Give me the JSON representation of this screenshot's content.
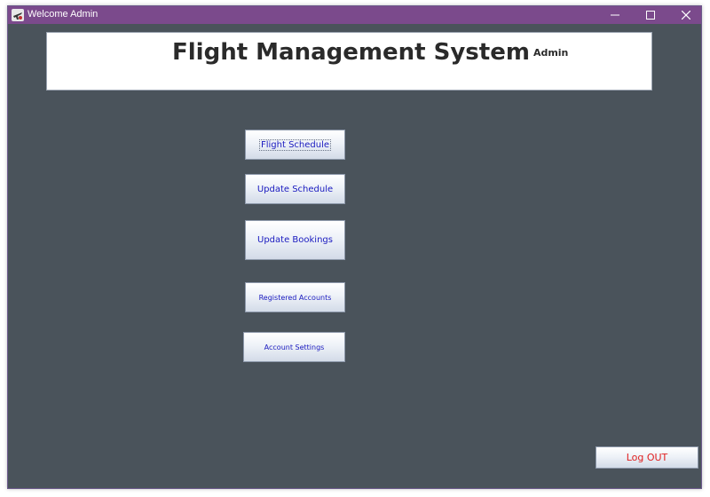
{
  "window": {
    "title": "Welcome Admin",
    "icon": "airplane-app-icon",
    "controls": [
      "minimize-icon",
      "maximize-icon",
      "close-icon"
    ]
  },
  "header": {
    "title": "Flight Management System",
    "role": "Admin"
  },
  "menu": {
    "flight_schedule": "Flight Schedule",
    "update_schedule": "Update Schedule",
    "update_bookings": "Update Bookings",
    "registered_accounts": "Registered Accounts",
    "account_settings": "Account Settings"
  },
  "footer": {
    "logout": "Log OUT"
  },
  "colors": {
    "titlebar": "#7b4a8c",
    "background": "#4a535b",
    "button_text": "#1a1abf",
    "logout_text": "#e02020"
  }
}
